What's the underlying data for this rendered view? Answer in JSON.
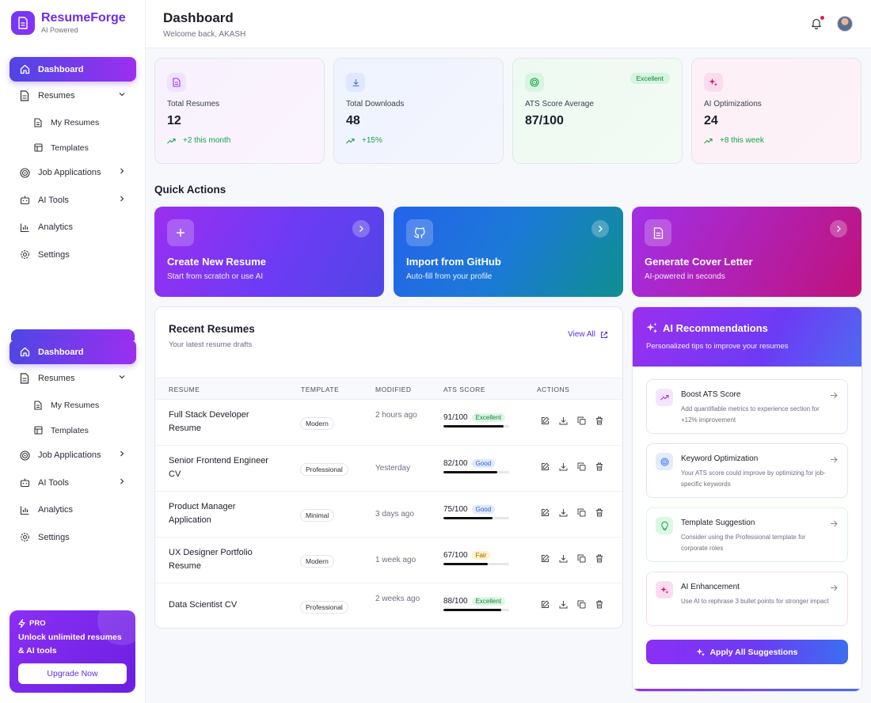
{
  "brand": {
    "name": "ResumeForge",
    "tagline": "AI Powered"
  },
  "nav": {
    "dashboard": "Dashboard",
    "resumes": "Resumes",
    "my_resumes": "My Resumes",
    "templates": "Templates",
    "job_applications": "Job Applications",
    "ai_tools": "AI Tools",
    "analytics": "Analytics",
    "settings": "Settings"
  },
  "promo": {
    "badge": "PRO",
    "text": "Unlock unlimited resumes & AI tools",
    "button": "Upgrade Now"
  },
  "header": {
    "title": "Dashboard",
    "welcome": "Welcome back, AKASH"
  },
  "stats": [
    {
      "label": "Total Resumes",
      "value": "12",
      "trend": "+2 this month"
    },
    {
      "label": "Total Downloads",
      "value": "48",
      "trend": "+15%"
    },
    {
      "label": "ATS Score Average",
      "value": "87/100",
      "tag": "Excellent"
    },
    {
      "label": "AI Optimizations",
      "value": "24",
      "trend": "+8 this week"
    }
  ],
  "quick_actions_title": "Quick Actions",
  "quick_actions": [
    {
      "title": "Create New Resume",
      "subtitle": "Start from scratch or use AI"
    },
    {
      "title": "Import from GitHub",
      "subtitle": "Auto-fill from your profile"
    },
    {
      "title": "Generate Cover Letter",
      "subtitle": "AI-powered in seconds"
    }
  ],
  "recent": {
    "title": "Recent Resumes",
    "subtitle": "Your latest resume drafts",
    "view_all": "View All",
    "columns": [
      "RESUME",
      "TEMPLATE",
      "MODIFIED",
      "ATS SCORE",
      "ACTIONS"
    ],
    "rows": [
      {
        "name": "Full Stack Developer Resume",
        "template": "Modern",
        "modified": "2 hours ago",
        "score": "91/100",
        "rating": "Excellent",
        "pct": 0.91
      },
      {
        "name": "Senior Frontend Engineer CV",
        "template": "Professional",
        "modified": "Yesterday",
        "score": "82/100",
        "rating": "Good",
        "pct": 0.82
      },
      {
        "name": "Product Manager Application",
        "template": "Minimal",
        "modified": "3 days ago",
        "score": "75/100",
        "rating": "Good",
        "pct": 0.75
      },
      {
        "name": "UX Designer Portfolio Resume",
        "template": "Modern",
        "modified": "1 week ago",
        "score": "67/100",
        "rating": "Fair",
        "pct": 0.67
      },
      {
        "name": "Data Scientist CV",
        "template": "Professional",
        "modified": "2 weeks ago",
        "score": "88/100",
        "rating": "Excellent",
        "pct": 0.88
      }
    ]
  },
  "ai": {
    "title": "AI Recommendations",
    "subtitle": "Personalized tips to improve your resumes",
    "items": [
      {
        "title": "Boost ATS Score",
        "desc": "Add quantifiable metrics to experience section for +12% improvement"
      },
      {
        "title": "Keyword Optimization",
        "desc": "Your ATS score could improve by optimizing for job-specific keywords"
      },
      {
        "title": "Template Suggestion",
        "desc": "Consider using the Professional template for corporate roles"
      },
      {
        "title": "AI Enhancement",
        "desc": "Use AI to rephrase 3 bullet points for stronger impact"
      }
    ],
    "apply": "Apply All Suggestions"
  },
  "colors": {
    "primary": "#6d3bf5",
    "success": "#16a34a",
    "accent_pink": "#c0127a"
  }
}
